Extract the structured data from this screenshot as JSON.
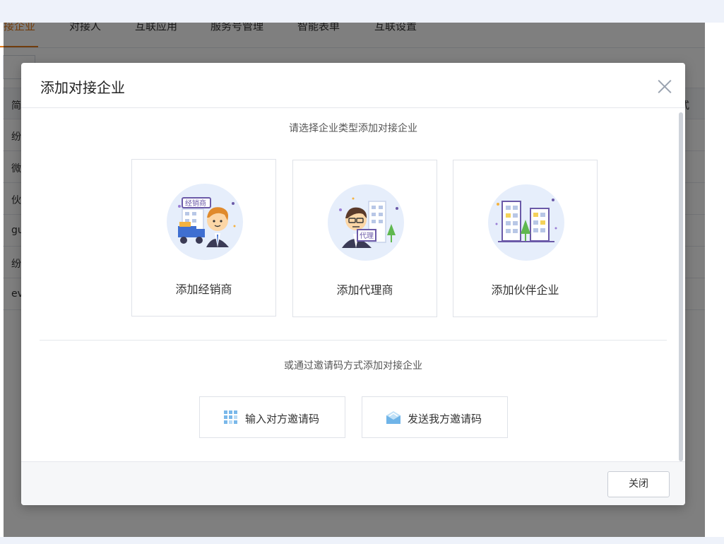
{
  "page": {
    "tabs": [
      {
        "label": "接企业",
        "active": true
      },
      {
        "label": "对接人"
      },
      {
        "label": "互联应用"
      },
      {
        "label": "服务号管理"
      },
      {
        "label": "智能表单"
      },
      {
        "label": "互联设置"
      }
    ],
    "table": {
      "header": {
        "c1": "简",
        "c2": "式"
      },
      "rows": [
        {
          "c1": "纷"
        },
        {
          "c1": "微"
        },
        {
          "c1": "伙"
        },
        {
          "c1": "gu"
        },
        {
          "c1": "纷"
        },
        {
          "c1": "ev"
        }
      ]
    }
  },
  "modal": {
    "title": "添加对接企业",
    "select_hint": "请选择企业类型添加对接企业",
    "cards": [
      {
        "label": "添加经销商",
        "icon": "dealer-illustration"
      },
      {
        "label": "添加代理商",
        "icon": "agent-illustration"
      },
      {
        "label": "添加伙伴企业",
        "icon": "partner-illustration"
      }
    ],
    "invite_hint": "或通过邀请码方式添加对接企业",
    "invite_buttons": [
      {
        "label": "输入对方邀请码",
        "icon": "grid-dots-icon"
      },
      {
        "label": "发送我方邀请码",
        "icon": "envelope-icon"
      }
    ],
    "close_label": "关闭"
  },
  "colors": {
    "accent_orange": "#e37b1b",
    "icon_blue": "#5aa9e6",
    "overlay": "rgba(0,0,0,0.5)"
  }
}
